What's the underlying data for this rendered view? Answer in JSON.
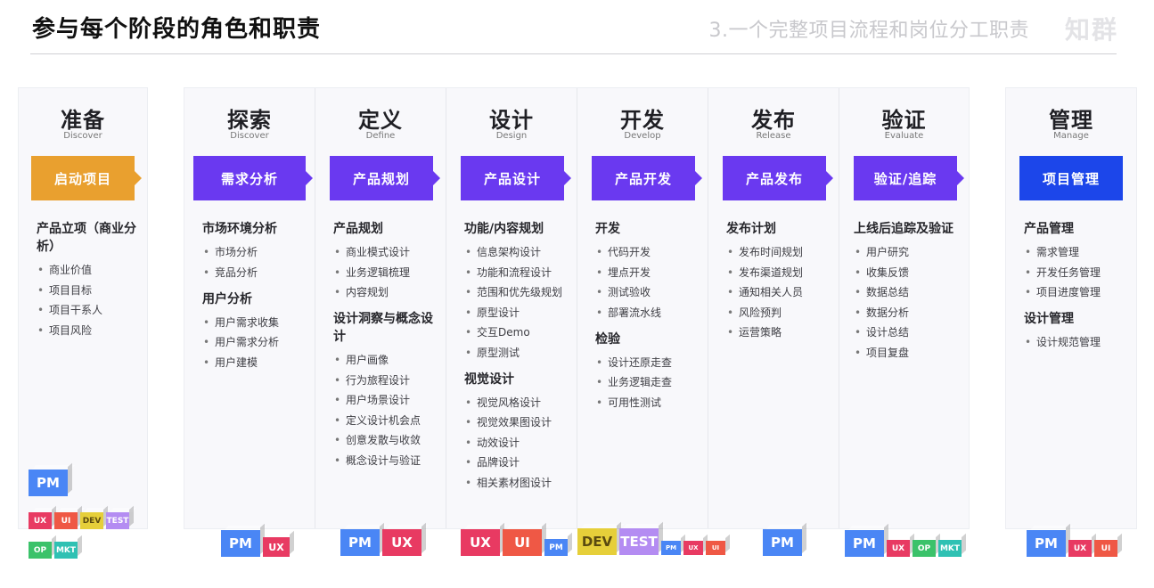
{
  "header": {
    "title": "参与每个阶段的角色和职责",
    "section": "3.一个完整项目流程和岗位分工职责",
    "logo": "知群"
  },
  "stages": [
    {
      "name": "准备",
      "sub": "Discover",
      "tag": "启动项目",
      "groups": [
        {
          "title": "产品立项（商业分析）",
          "items": [
            "商业价值",
            "项目目标",
            "项目干系人",
            "项目风险"
          ]
        }
      ],
      "roles": [
        "PM",
        "UX",
        "UI",
        "DEV",
        "TEST",
        "OP",
        "MKT"
      ]
    },
    {
      "name": "探索",
      "sub": "Discover",
      "tag": "需求分析",
      "groups": [
        {
          "title": "市场环境分析",
          "items": [
            "市场分析",
            "竞品分析"
          ]
        },
        {
          "title": "用户分析",
          "items": [
            "用户需求收集",
            "用户需求分析",
            "用户建模"
          ]
        }
      ],
      "roles": [
        "PM",
        "UX"
      ]
    },
    {
      "name": "定义",
      "sub": "Define",
      "tag": "产品规划",
      "groups": [
        {
          "title": "产品规划",
          "items": [
            "商业模式设计",
            "业务逻辑梳理",
            "内容规划"
          ]
        },
        {
          "title": "设计洞察与概念设计",
          "items": [
            "用户画像",
            "行为旅程设计",
            "用户场景设计",
            "定义设计机会点",
            "创意发散与收敛",
            "概念设计与验证"
          ]
        }
      ],
      "roles": [
        "PM",
        "UX"
      ]
    },
    {
      "name": "设计",
      "sub": "Design",
      "tag": "产品设计",
      "groups": [
        {
          "title": "功能/内容规划",
          "items": [
            "信息架构设计",
            "功能和流程设计",
            "范围和优先级规划",
            "原型设计",
            "交互Demo",
            "原型测试"
          ]
        },
        {
          "title": "视觉设计",
          "items": [
            "视觉风格设计",
            "视觉效果图设计",
            "动效设计",
            "品牌设计",
            "相关素材图设计"
          ]
        }
      ],
      "roles": [
        "UX",
        "UI",
        "PM"
      ]
    },
    {
      "name": "开发",
      "sub": "Develop",
      "tag": "产品开发",
      "groups": [
        {
          "title": "开发",
          "items": [
            "代码开发",
            "埋点开发",
            "测试验收",
            "部署流水线"
          ]
        },
        {
          "title": "检验",
          "items": [
            "设计还原走查",
            "业务逻辑走查",
            "可用性测试"
          ]
        }
      ],
      "roles": [
        "DEV",
        "TEST",
        "PM",
        "UX",
        "UI"
      ]
    },
    {
      "name": "发布",
      "sub": "Release",
      "tag": "产品发布",
      "groups": [
        {
          "title": "发布计划",
          "items": [
            "发布时间规划",
            "发布渠道规划",
            "通知相关人员",
            "风险预判",
            "运营策略"
          ]
        }
      ],
      "roles": [
        "PM"
      ]
    },
    {
      "name": "验证",
      "sub": "Evaluate",
      "tag": "验证/追踪",
      "groups": [
        {
          "title": "上线后追踪及验证",
          "items": [
            "用户研究",
            "收集反馈",
            "数据总结",
            "数据分析",
            "设计总结",
            "项目复盘"
          ]
        }
      ],
      "roles": [
        "PM",
        "UX",
        "OP",
        "MKT"
      ]
    },
    {
      "name": "管理",
      "sub": "Manage",
      "tag": "项目管理",
      "groups": [
        {
          "title": "产品管理",
          "items": [
            "需求管理",
            "开发任务管理",
            "项目进度管理"
          ]
        },
        {
          "title": "设计管理",
          "items": [
            "设计规范管理"
          ]
        }
      ],
      "roles": [
        "PM",
        "UX",
        "UI"
      ]
    }
  ],
  "colors": {
    "tag_purple": "#6a39f0",
    "tag_orange": "#e9a02f",
    "tag_blue": "#1c46ea",
    "role_pm": "#4a86f5",
    "role_ux": "#e83a62",
    "role_ui": "#ef5845",
    "role_dev": "#e6cf3a",
    "role_test": "#b48cf2",
    "role_op": "#3bc26a",
    "role_mkt": "#2fc1b3"
  }
}
